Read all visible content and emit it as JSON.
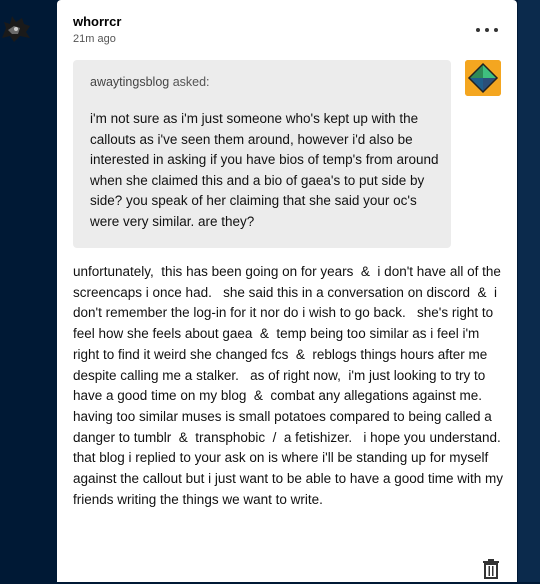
{
  "post": {
    "username": "whorrcr",
    "timestamp": "21m ago",
    "asker_name": "awaytingsblog",
    "asker_suffix": " asked:",
    "question": "i'm not sure as i'm just someone who's kept up with the callouts as i've seen them around, however i'd also be interested in asking if you have bios of temp's from around when she claimed this and a bio of gaea's to put side by side? you speak of her claiming that she said your oc's were very similar. are they?",
    "answer": "unfortunately,  this has been going on for years  &  i don't have all of the screencaps i once had.   she said this in a conversation on discord  &  i don't remember the log-in for it nor do i wish to go back.   she's right to feel how she feels about gaea  &  temp being too similar as i feel i'm right to find it weird she changed fcs  &  reblogs things hours after me despite calling me a stalker.   as of right now,  i'm just looking to try to have a good time on my blog  &  combat any allegations against me.   having too similar muses is small potatoes compared to being called a danger to tumblr  &  transphobic  /  a fetishizer.   i hope you understand.   that blog i replied to your ask on is where i'll be standing up for myself against the callout but i just want to be able to have a good time with my friends writing the things we want to write."
  },
  "icons": {
    "left_avatar": "dark-creature-avatar-icon",
    "more": "more-options-icon",
    "ask_avatar": "diamond-avatar-icon",
    "footer": "trash-icon"
  },
  "colors": {
    "background": "#001935",
    "card": "#ffffff",
    "ask_box": "#ececec",
    "ask_avatar": "#f4a620"
  }
}
